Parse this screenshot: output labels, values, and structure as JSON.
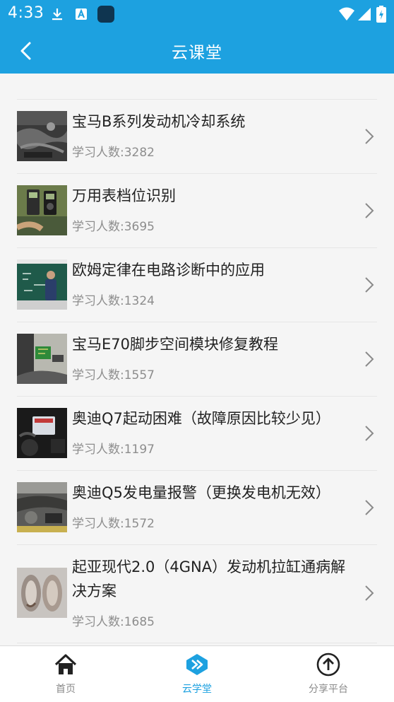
{
  "status_bar": {
    "time": "4:33"
  },
  "header": {
    "title": "云课堂"
  },
  "courses": [
    {
      "title": "宝马B系列发动机冷却系统",
      "count": "学习人数:3282"
    },
    {
      "title": "万用表档位识别",
      "count": "学习人数:3695"
    },
    {
      "title": "欧姆定律在电路诊断中的应用",
      "count": "学习人数:1324"
    },
    {
      "title": "宝马E70脚步空间模块修复教程",
      "count": "学习人数:1557"
    },
    {
      "title": "奥迪Q7起动困难（故障原因比较少见）",
      "count": "学习人数:1197"
    },
    {
      "title": "奥迪Q5发电量报警（更换发电机无效）",
      "count": "学习人数:1572"
    },
    {
      "title": "起亚现代2.0（4GNA）发动机拉缸通病解决方案",
      "count": "学习人数:1685"
    }
  ],
  "bottom_nav": [
    {
      "label": "首页",
      "icon": "home-icon"
    },
    {
      "label": "云学堂",
      "icon": "cloud-school-icon"
    },
    {
      "label": "分享平台",
      "icon": "upload-icon"
    }
  ],
  "colors": {
    "primary": "#1da1e0",
    "text": "#222222",
    "muted": "#8d8d8d",
    "inactive": "#8a8a8a"
  }
}
